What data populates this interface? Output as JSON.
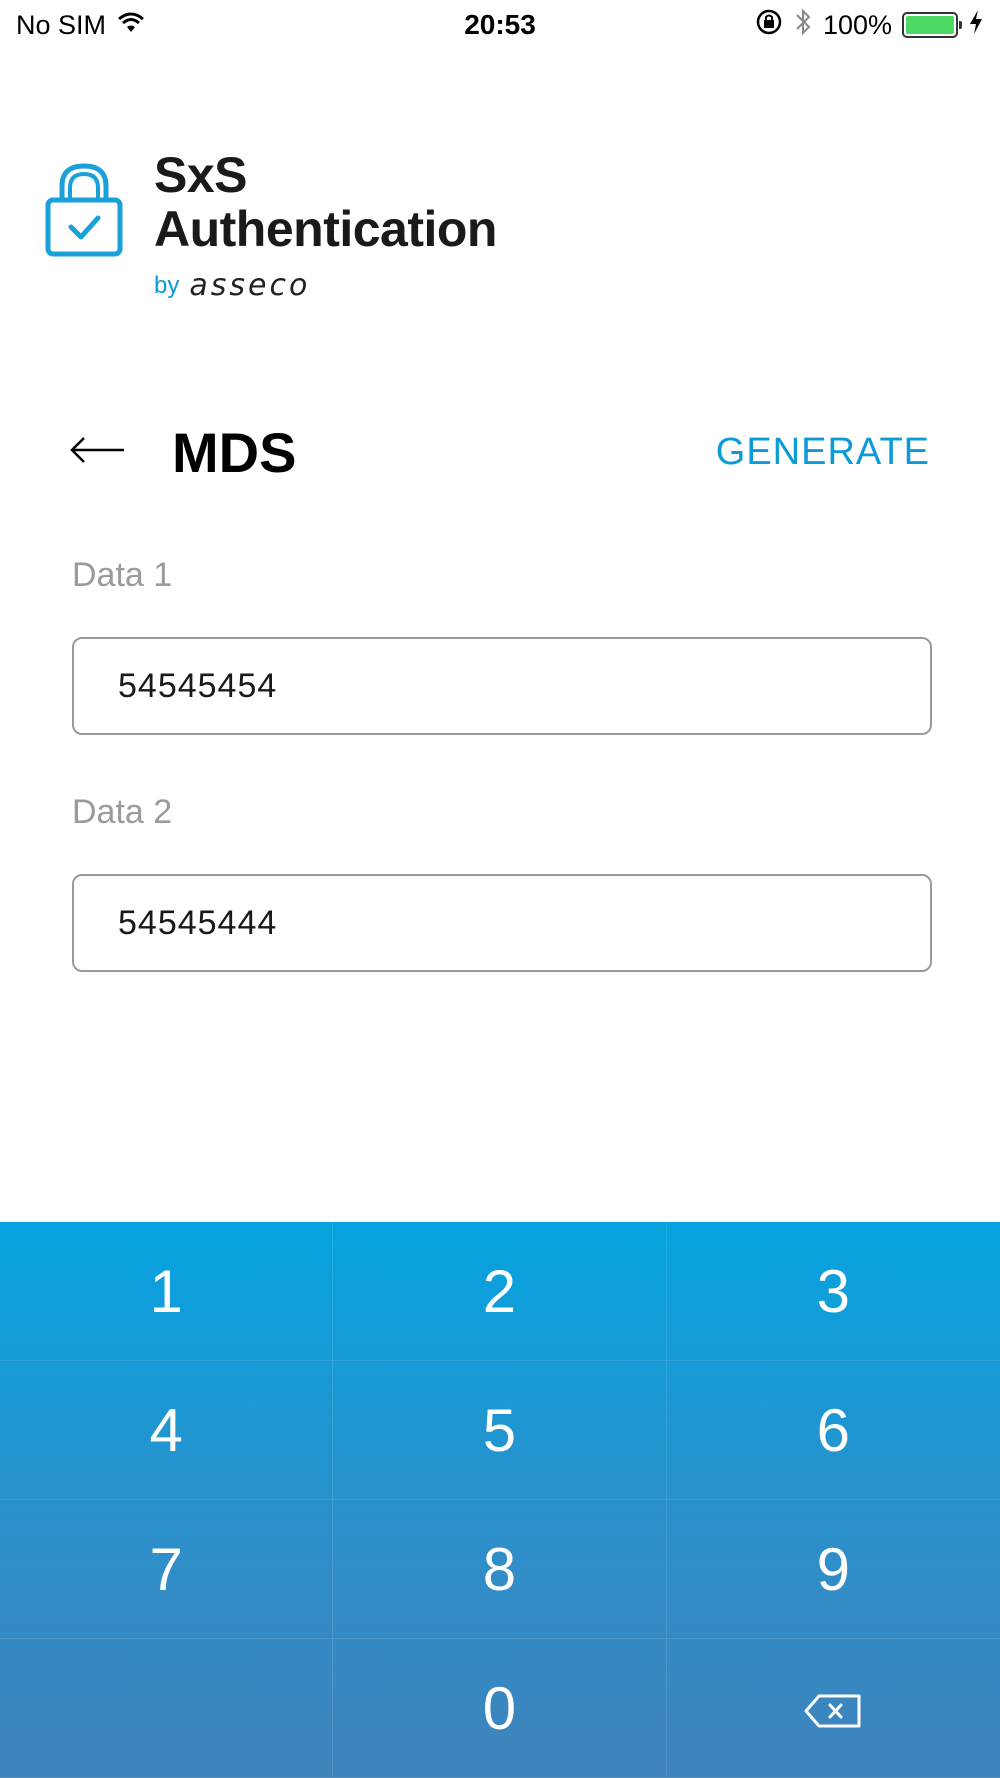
{
  "status_bar": {
    "carrier": "No SIM",
    "time": "20:53",
    "battery_percent": "100%",
    "battery_level": 1.0,
    "battery_color": "#4cd964"
  },
  "logo": {
    "line1": "SxS",
    "line2": "Authentication",
    "by": "by",
    "brand": "asseco",
    "icon": "lock-check-icon"
  },
  "header": {
    "title": "MDS",
    "back_icon": "arrow-left-icon",
    "action_label": "GENERATE"
  },
  "fields": [
    {
      "label": "Data 1",
      "value": "54545454"
    },
    {
      "label": "Data 2",
      "value": "54545444"
    }
  ],
  "keypad": {
    "keys": [
      "1",
      "2",
      "3",
      "4",
      "5",
      "6",
      "7",
      "8",
      "9",
      "",
      "0",
      ""
    ],
    "backspace_icon": "backspace-icon"
  },
  "colors": {
    "accent": "#0a9bd8",
    "keypad_top": "#05a3df",
    "keypad_bottom": "#3f83bb"
  }
}
